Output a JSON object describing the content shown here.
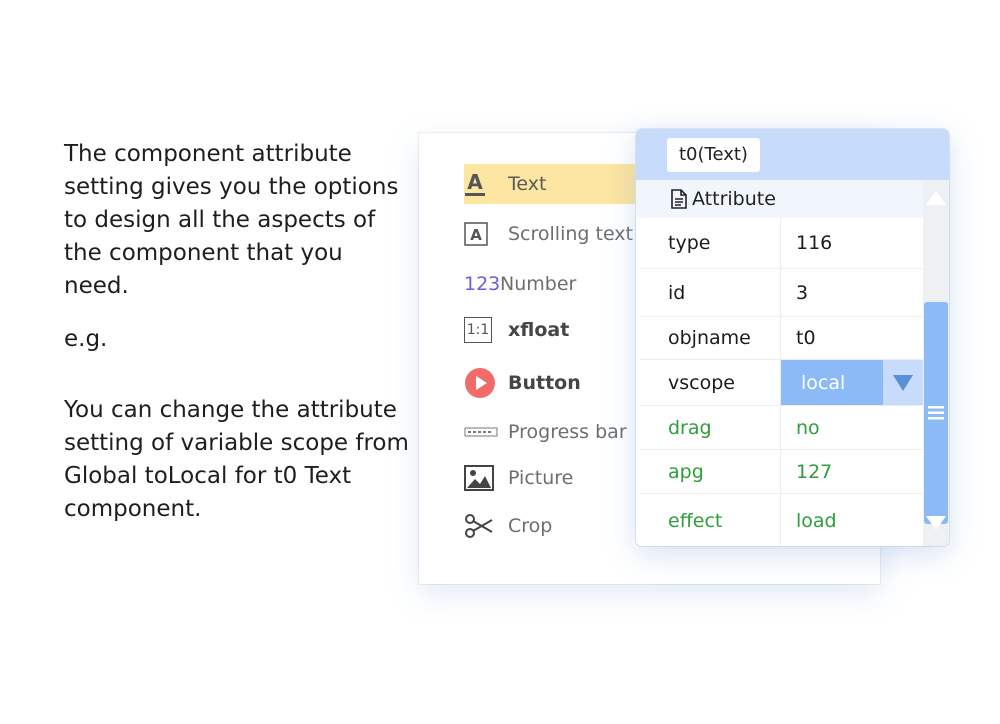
{
  "description": {
    "p1": "The component attribute setting gives you the options to design all the aspects of the component that you need.",
    "p2": "e.g.",
    "p3": "You can change the attribute setting of variable scope from Global toLocal for t0 Text component."
  },
  "toolbox": {
    "items": [
      {
        "label": "Text",
        "icon": "text-underline-icon",
        "selected": true
      },
      {
        "label": "Scrolling text",
        "icon": "scrolling-text-icon"
      },
      {
        "label": "Number",
        "icon": "number-123-icon"
      },
      {
        "label": "xfloat",
        "icon": "ratio-1-1-icon"
      },
      {
        "label": "Button",
        "icon": "play-button-icon"
      },
      {
        "label": "Progress bar",
        "icon": "progress-bar-icon"
      },
      {
        "label": "Picture",
        "icon": "picture-icon"
      },
      {
        "label": "Crop",
        "icon": "scissors-icon"
      }
    ],
    "number_icon_text": "123",
    "xfloat_icon_text": "1:1"
  },
  "attribute_panel": {
    "object_title": "t0(Text)",
    "section_label": "Attribute",
    "rows": [
      {
        "key": "type",
        "value": "116"
      },
      {
        "key": "id",
        "value": "3"
      },
      {
        "key": "objname",
        "value": "t0"
      },
      {
        "key": "vscope",
        "value": "local"
      },
      {
        "key": "drag",
        "value": "no"
      },
      {
        "key": "apg",
        "value": "127"
      },
      {
        "key": "effect",
        "value": "load"
      }
    ]
  },
  "colors": {
    "selected_tool": "#fde5a2",
    "panel_header": "#c7dcfa",
    "selection_blue": "#8cbaf6",
    "green_text": "#2e9e3a",
    "number_icon": "#6a5fd8",
    "button_icon": "#f26b6b"
  }
}
